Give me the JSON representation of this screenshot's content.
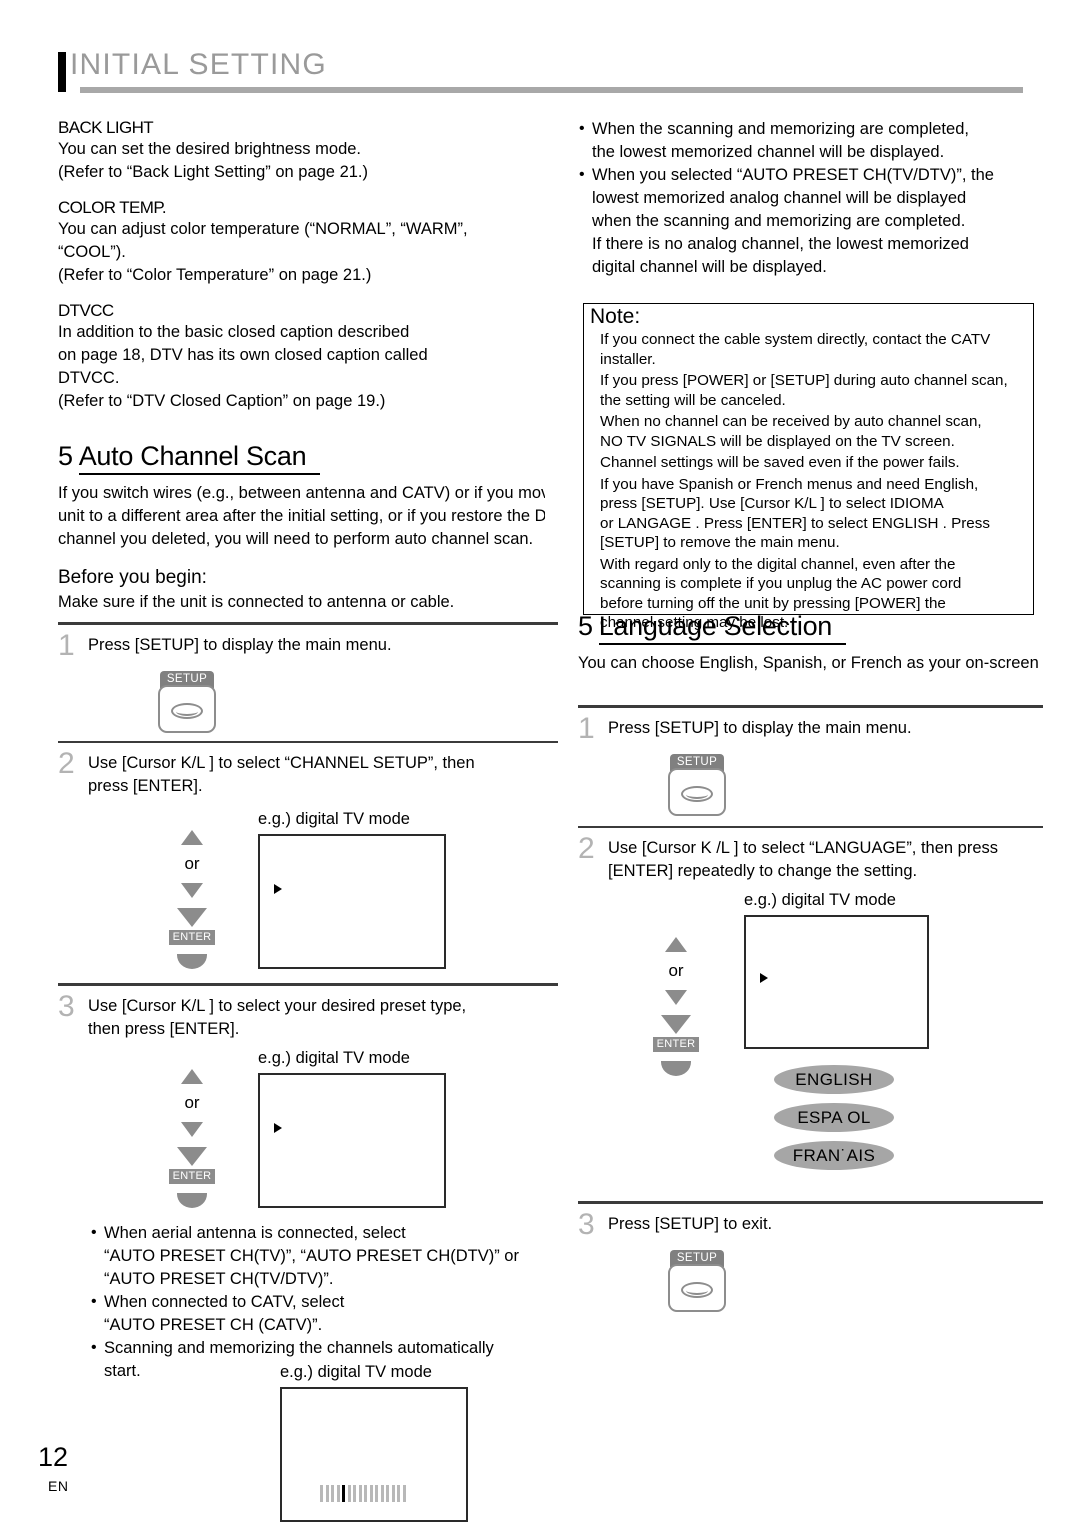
{
  "header": {
    "title": "INITIAL SETTING"
  },
  "footer": {
    "page_number": "12",
    "language_code": "EN"
  },
  "left_column": {
    "settings": [
      {
        "heading": "BACK LIGHT",
        "lines": [
          "You can set the desired brightness mode.",
          "(Refer to “Back Light Setting” on page 21.)"
        ]
      },
      {
        "heading": "COLOR TEMP.",
        "lines": [
          "You can adjust color temperature (“NORMAL”, “WARM”,",
          "“COOL”).",
          "(Refer to “Color Temperature” on page 21.)"
        ]
      },
      {
        "heading": "DTVCC",
        "lines": [
          "In addition to the basic closed caption described",
          "on page 18, DTV has its own closed caption called",
          "DTVCC.",
          "(Refer to “DTV Closed Caption” on page 19.)"
        ]
      }
    ],
    "section": {
      "number": "5",
      "title": "Auto Channel Scan",
      "intro_lines": [
        "If you switch wires (e.g., between antenna and CATV) or if you move the",
        "unit to a different area after the initial setting, or if you restore the DTV",
        "channel you deleted, you will need to perform auto channel scan."
      ],
      "before_heading": "Before you begin:",
      "before_text": "Make sure if the unit is connected to antenna or cable."
    },
    "steps": [
      {
        "number": "1",
        "text": "Press [SETUP] to display the main menu.",
        "key_label": "SETUP"
      },
      {
        "number": "2",
        "text_lines": [
          "Use [Cursor K/L ] to select “CHANNEL SETUP”, then",
          "press [ENTER]."
        ],
        "or_label": "or",
        "enter_label": "ENTER",
        "screen_caption": "e.g.) digital TV mode"
      },
      {
        "number": "3",
        "text_lines": [
          "Use [Cursor K/L ] to select your desired preset type,",
          "then press [ENTER]."
        ],
        "or_label": "or",
        "enter_label": "ENTER",
        "screen_caption": "e.g.) digital TV mode"
      }
    ],
    "notes": [
      [
        "When aerial antenna is connected, select",
        "“AUTO PRESET CH(TV)”, “AUTO PRESET CH(DTV)” or",
        "“AUTO PRESET CH(TV/DTV)”."
      ],
      [
        "When connected to CATV, select",
        "“AUTO PRESET CH (CATV)”."
      ],
      [
        "Scanning and memorizing the channels automatically",
        "start."
      ]
    ],
    "scan_screen_caption": "e.g.) digital TV mode"
  },
  "right_column": {
    "top_bullets": [
      [
        "When the scanning and memorizing are completed,",
        "the lowest memorized channel will be displayed."
      ],
      [
        "When you selected “AUTO PRESET CH(TV/DTV)”, the",
        "lowest memorized analog channel will be displayed",
        "when the scanning and memorizing are completed.",
        "If there is no analog channel, the lowest memorized",
        "digital channel will be displayed."
      ]
    ],
    "note_box": {
      "title": "Note:",
      "lines": [
        "If you connect the cable system directly, contact the CATV",
        "installer.",
        "If you press [POWER] or [SETUP] during auto channel scan,",
        "the setting will be canceled.",
        "When no channel can be received by auto channel scan,",
        " NO TV SIGNALS  will be displayed on the TV screen.",
        "Channel settings will be saved even if the power fails.",
        "If you have Spanish or French menus and need English,",
        "press [SETUP]. Use [Cursor K/L ] to select  IDIOMA",
        "or  LANGAGE . Press [ENTER] to select  ENGLISH . Press",
        "[SETUP] to remove the main menu.",
        "With regard only to the digital channel, even after the",
        "scanning is complete if you unplug the AC power cord",
        "before turning off the unit by pressing [POWER] the",
        "channel setting may be lost."
      ]
    },
    "section": {
      "number": "5",
      "title": "Language Selection",
      "intro": "You can choose English, Spanish, or French as your on-screen language."
    },
    "steps": [
      {
        "number": "1",
        "text": "Press [SETUP] to display the main menu.",
        "key_label": "SETUP"
      },
      {
        "number": "2",
        "text_lines": [
          "Use [Cursor K /L ] to select “LANGUAGE”, then press",
          "[ENTER] repeatedly to change the setting."
        ],
        "or_label": "or",
        "enter_label": "ENTER",
        "screen_caption": "e.g.) digital TV mode"
      },
      {
        "number": "3",
        "text": "Press [SETUP] to exit.",
        "key_label": "SETUP"
      }
    ],
    "language_options": [
      "ENGLISH",
      "ESPA OL",
      "FRAN˙AIS"
    ]
  }
}
